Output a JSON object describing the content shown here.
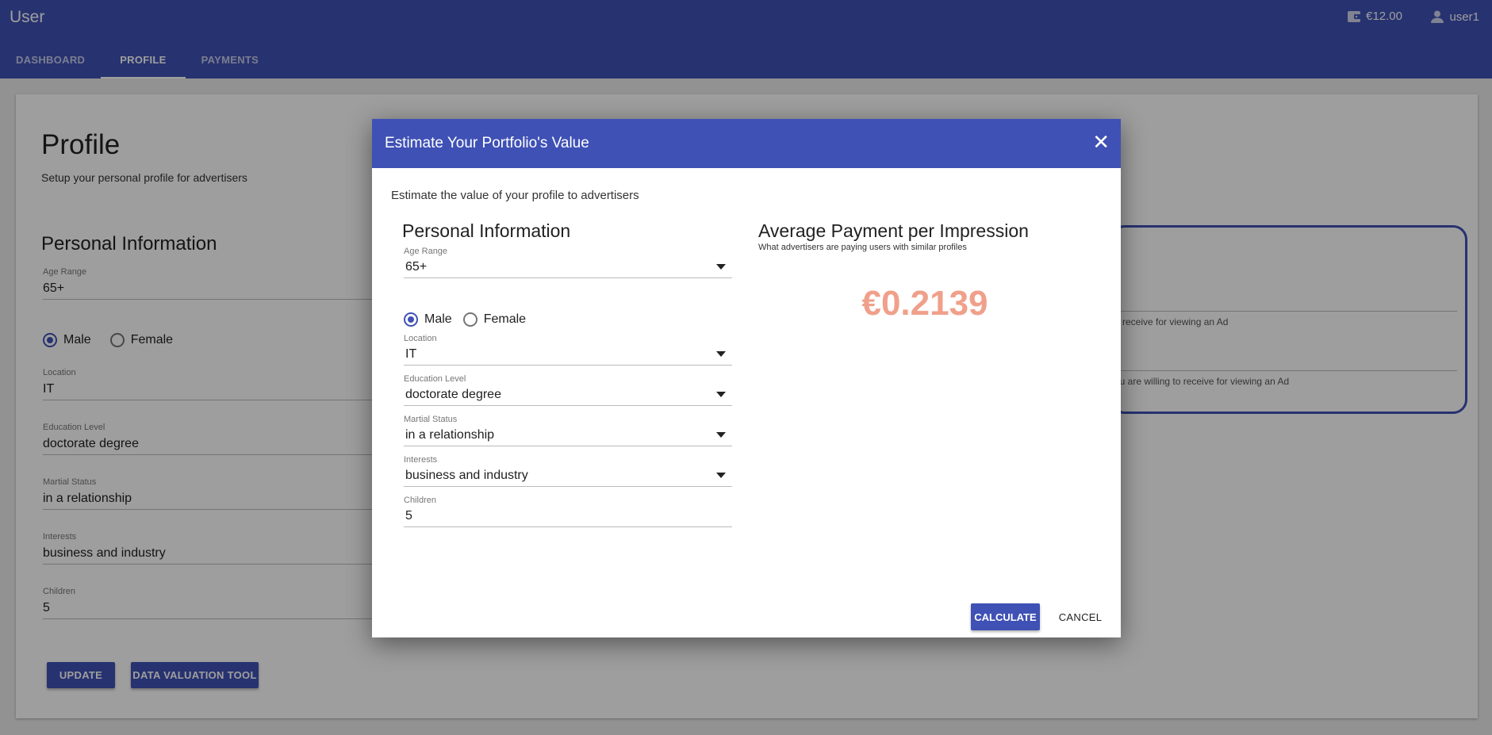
{
  "header": {
    "title": "User",
    "wallet_balance": "€12.00",
    "username": "user1",
    "icons": {
      "wallet": "wallet-icon",
      "user": "user-icon"
    }
  },
  "tabs": [
    {
      "label": "DASHBOARD",
      "active": false
    },
    {
      "label": "PROFILE",
      "active": true
    },
    {
      "label": "PAYMENTS",
      "active": false
    }
  ],
  "profile": {
    "title": "Profile",
    "subtitle": "Setup your personal profile for advertisers",
    "section_title": "Personal Information",
    "fields": {
      "age_range": {
        "label": "Age Range",
        "value": "65+"
      },
      "gender": {
        "options": [
          "Male",
          "Female"
        ],
        "selected": "Male"
      },
      "location": {
        "label": "Location",
        "value": "IT"
      },
      "education": {
        "label": "Education Level",
        "value": "doctorate degree"
      },
      "marital": {
        "label": "Martial Status",
        "value": "in a relationship"
      },
      "interests": {
        "label": "Interests",
        "value": "business and industry"
      },
      "children": {
        "label": "Children",
        "value": "5"
      }
    },
    "buttons": {
      "update": "UPDATE",
      "valuation": "DATA VALUATION TOOL"
    },
    "side_hints": [
      "o receive for viewing an Ad",
      "ou are willing to receive for viewing an Ad"
    ]
  },
  "dialog": {
    "title": "Estimate Your Portfolio's Value",
    "description": "Estimate the value of your profile to advertisers",
    "left_title": "Personal Information",
    "right_title": "Average Payment per Impression",
    "right_subtitle": "What advertisers are paying users with similar profiles",
    "estimate": "€0.2139",
    "fields": {
      "age_range": {
        "label": "Age Range",
        "value": "65+"
      },
      "gender": {
        "options": [
          "Male",
          "Female"
        ],
        "selected": "Male"
      },
      "location": {
        "label": "Location",
        "value": "IT"
      },
      "education": {
        "label": "Education Level",
        "value": "doctorate degree"
      },
      "marital": {
        "label": "Martial Status",
        "value": "in a relationship"
      },
      "interests": {
        "label": "Interests",
        "value": "business and industry"
      },
      "children": {
        "label": "Children",
        "value": "5"
      }
    },
    "buttons": {
      "calculate": "CALCULATE",
      "cancel": "CANCEL"
    },
    "close_icon": "close-icon",
    "close_glyph": "✕"
  },
  "colors": {
    "primary": "#3f51b5",
    "estimate": "#f0a08a"
  }
}
